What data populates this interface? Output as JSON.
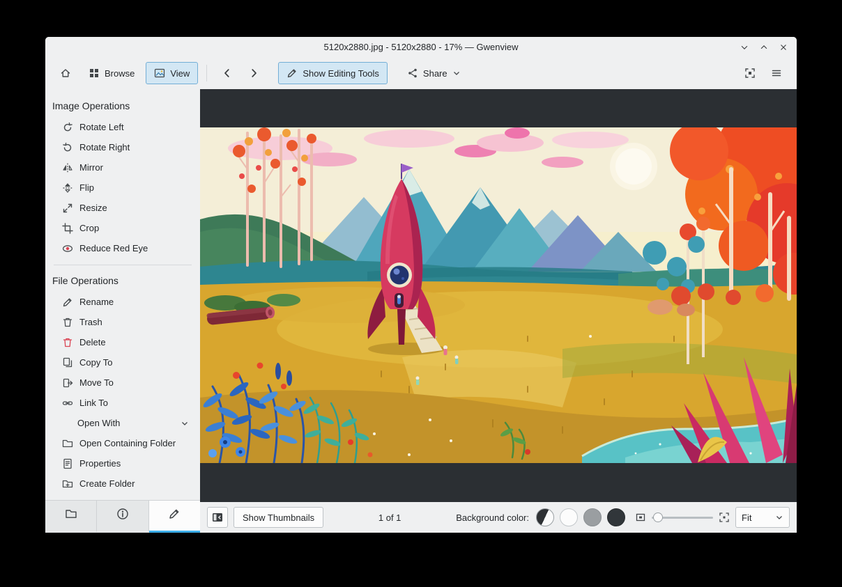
{
  "window_title": "5120x2880.jpg - 5120x2880 - 17% — Gwenview",
  "toolbar": {
    "browse": "Browse",
    "view": "View",
    "show_editing_tools": "Show Editing Tools",
    "share": "Share",
    "icons": [
      "home-icon",
      "browse-grid-icon",
      "view-image-icon",
      "back-icon",
      "forward-icon",
      "edit-pencil-icon",
      "share-icon",
      "chevron-down-icon",
      "fit-screen-icon",
      "hamburger-menu-icon"
    ]
  },
  "sidebar": {
    "image_operations": {
      "title": "Image Operations",
      "items": [
        {
          "label": "Rotate Left",
          "icon": "rotate-left-icon"
        },
        {
          "label": "Rotate Right",
          "icon": "rotate-right-icon"
        },
        {
          "label": "Mirror",
          "icon": "mirror-icon"
        },
        {
          "label": "Flip",
          "icon": "flip-icon"
        },
        {
          "label": "Resize",
          "icon": "resize-icon"
        },
        {
          "label": "Crop",
          "icon": "crop-icon"
        },
        {
          "label": "Reduce Red Eye",
          "icon": "red-eye-icon"
        }
      ]
    },
    "file_operations": {
      "title": "File Operations",
      "items": [
        {
          "label": "Rename",
          "icon": "rename-icon"
        },
        {
          "label": "Trash",
          "icon": "trash-icon"
        },
        {
          "label": "Delete",
          "icon": "delete-icon"
        },
        {
          "label": "Copy To",
          "icon": "copy-icon"
        },
        {
          "label": "Move To",
          "icon": "move-icon"
        },
        {
          "label": "Link To",
          "icon": "link-icon"
        },
        {
          "label": "Open With",
          "icon": "chevron-down-icon"
        },
        {
          "label": "Open Containing Folder",
          "icon": "open-folder-icon"
        },
        {
          "label": "Properties",
          "icon": "properties-icon"
        },
        {
          "label": "Create Folder",
          "icon": "create-folder-icon"
        }
      ]
    },
    "tabs": [
      {
        "icon": "folder-tab-icon"
      },
      {
        "icon": "info-tab-icon"
      },
      {
        "icon": "edit-tab-icon",
        "active": true
      }
    ]
  },
  "statusbar": {
    "show_thumbnails": "Show Thumbnails",
    "page_indicator": "1 of 1",
    "background_color_label": "Background color:",
    "zoom_mode": "Fit",
    "background_swatches": [
      "auto",
      "white",
      "gray",
      "dark"
    ]
  },
  "colors": {
    "accent": "#3daee9",
    "window_bg": "#eff0f1",
    "viewer_bg": "#2b2f33",
    "delete_red": "#da4453"
  }
}
